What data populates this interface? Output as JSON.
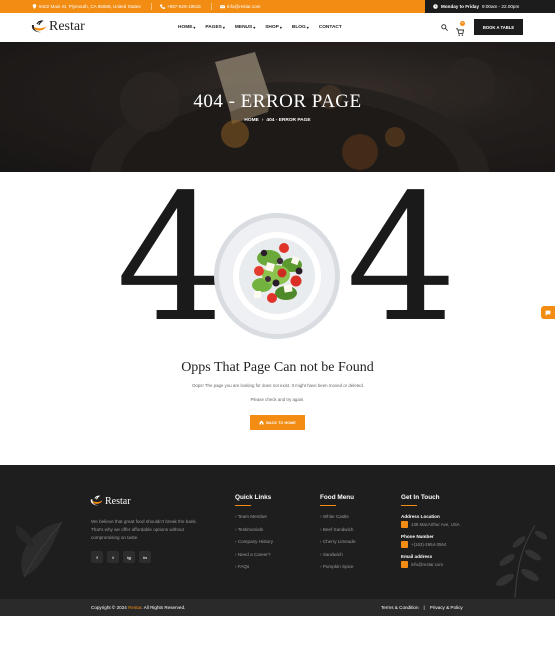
{
  "topbar": {
    "address": "9402 Main St, Plymouth, CA 95669, United States",
    "phone": "+987-629-19815",
    "email": "info@restar.com",
    "hours_label": "Monday to Friday",
    "hours_value": "9:00am - 22.00pm"
  },
  "header": {
    "logo_text": "Restar",
    "nav": [
      "HOME",
      "PAGES",
      "MENUS",
      "SHOP",
      "BLOG",
      "CONTACT"
    ],
    "cart_count": "0",
    "book_button": "BOOK A TABLE"
  },
  "hero": {
    "title": "404 - ERROR PAGE",
    "breadcrumb_home": "HOME",
    "breadcrumb_current": "404 - ERROR PAGE"
  },
  "error": {
    "digit_left": "4",
    "digit_right": "4",
    "heading": "Opps That Page Can not be Found",
    "text": "Oops! The page you are looking for does not exist. It might have been moved or deleted.",
    "text2": "Please check and try again.",
    "button": "BACK TO HOME"
  },
  "footer": {
    "logo_text": "Restar",
    "about": "We believe that great food shouldn't break the bank. That's why we offer affordable options without compromising on taste.",
    "socials": [
      "f",
      "t",
      "ig",
      "in"
    ],
    "quick_links_title": "Quick Links",
    "quick_links": [
      "Team Member",
      "Testimonials",
      "Company History",
      "Need a Career?",
      "FAQs"
    ],
    "food_menu_title": "Food Menu",
    "food_menu": [
      "White Castle",
      "Beef Sandwich",
      "Cherry Limeade",
      "Sandwich",
      "Pumpkin Spice"
    ],
    "contact_title": "Get In Touch",
    "address_label": "Address Location",
    "address_value": "138 MacArthur Ave, USA",
    "phone_label": "Phone Number",
    "phone_value": "+(163)-2654-3564",
    "email_label": "Email address",
    "email_value": "info@restar.com"
  },
  "bottom": {
    "copy_prefix": "Copyright © 2024",
    "copy_brand": "Restar",
    "copy_suffix": ". All Rights Reserved.",
    "terms": "Terms & Condition",
    "divider": "|",
    "privacy": "Privacy & Policy"
  },
  "colors": {
    "accent": "#f28c12",
    "dark": "#1e1e1e"
  }
}
